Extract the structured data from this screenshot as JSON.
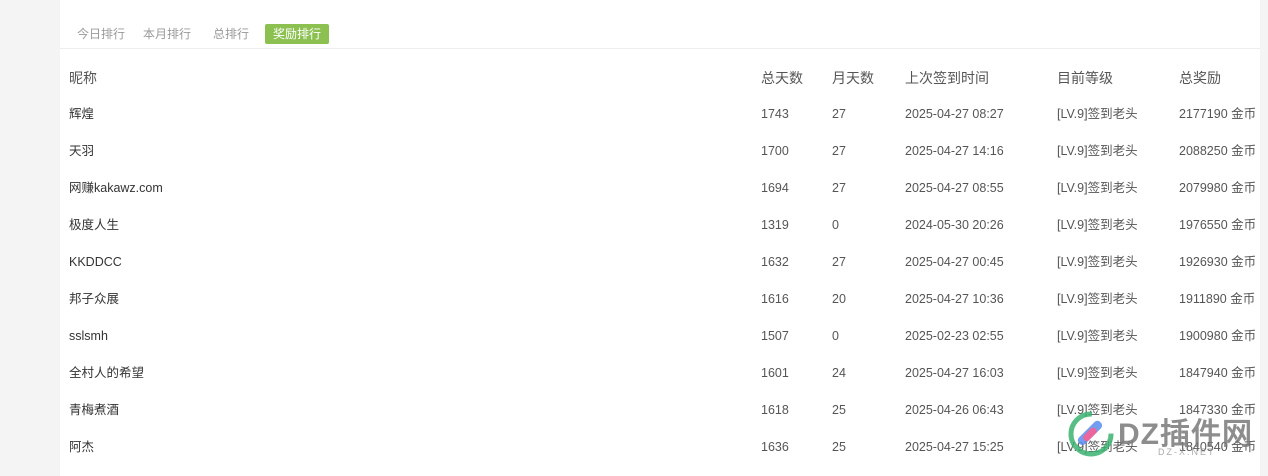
{
  "tabs": [
    {
      "label": "今日排行",
      "active": false
    },
    {
      "label": "本月排行",
      "active": false
    },
    {
      "label": "总排行",
      "active": false
    },
    {
      "label": "奖励排行",
      "active": true
    }
  ],
  "accent_color": "#8cc152",
  "table": {
    "headers": [
      "昵称",
      "总天数",
      "月天数",
      "上次签到时间",
      "目前等级",
      "总奖励"
    ],
    "rows": [
      {
        "nick": "辉煌",
        "total_days": "1743",
        "month_days": "27",
        "last_sign": "2025-04-27 08:27",
        "level": "[LV.9]签到老头",
        "reward": "2177190 金币"
      },
      {
        "nick": "天羽",
        "total_days": "1700",
        "month_days": "27",
        "last_sign": "2025-04-27 14:16",
        "level": "[LV.9]签到老头",
        "reward": "2088250 金币"
      },
      {
        "nick": "网赚kakawz.com",
        "total_days": "1694",
        "month_days": "27",
        "last_sign": "2025-04-27 08:55",
        "level": "[LV.9]签到老头",
        "reward": "2079980 金币"
      },
      {
        "nick": "极度人生",
        "total_days": "1319",
        "month_days": "0",
        "last_sign": "2024-05-30 20:26",
        "level": "[LV.9]签到老头",
        "reward": "1976550 金币"
      },
      {
        "nick": "KKDDCC",
        "total_days": "1632",
        "month_days": "27",
        "last_sign": "2025-04-27 00:45",
        "level": "[LV.9]签到老头",
        "reward": "1926930 金币"
      },
      {
        "nick": "邦子众展",
        "total_days": "1616",
        "month_days": "20",
        "last_sign": "2025-04-27 10:36",
        "level": "[LV.9]签到老头",
        "reward": "1911890 金币"
      },
      {
        "nick": "sslsmh",
        "total_days": "1507",
        "month_days": "0",
        "last_sign": "2025-02-23 02:55",
        "level": "[LV.9]签到老头",
        "reward": "1900980 金币"
      },
      {
        "nick": "全村人的希望",
        "total_days": "1601",
        "month_days": "24",
        "last_sign": "2025-04-27 16:03",
        "level": "[LV.9]签到老头",
        "reward": "1847940 金币"
      },
      {
        "nick": "青梅煮酒",
        "total_days": "1618",
        "month_days": "25",
        "last_sign": "2025-04-26 06:43",
        "level": "[LV.9]签到老头",
        "reward": "1847330 金币"
      },
      {
        "nick": "阿杰",
        "total_days": "1636",
        "month_days": "25",
        "last_sign": "2025-04-27 15:25",
        "level": "[LV.9]签到老头",
        "reward": "1840540 金币"
      }
    ]
  },
  "watermark": {
    "text": "DZ插件网",
    "sub": "DZ-X.NET"
  }
}
